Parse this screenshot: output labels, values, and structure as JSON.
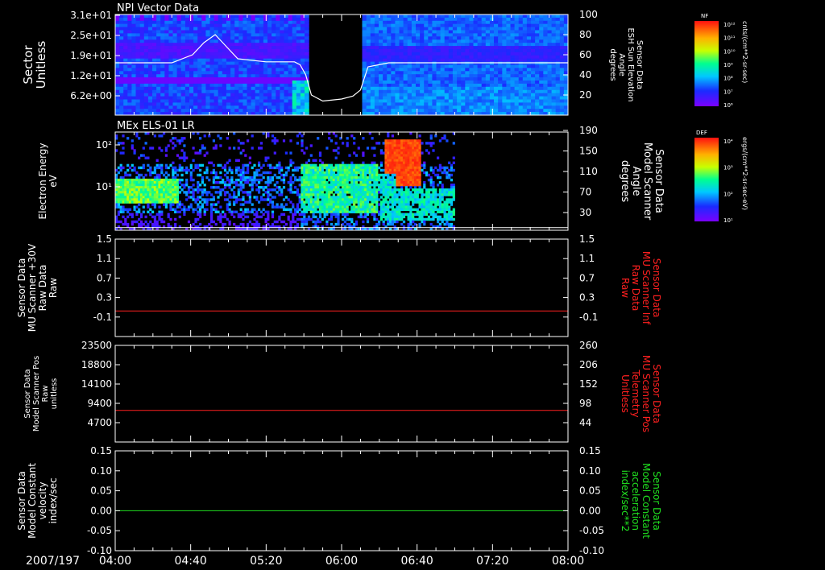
{
  "time_axis": {
    "date_label": "2007/197",
    "ticks": [
      "04:00",
      "04:40",
      "05:20",
      "06:00",
      "06:40",
      "07:20",
      "08:00"
    ],
    "range": [
      "04:00",
      "08:00"
    ]
  },
  "colors": {
    "background": "#000000",
    "foreground": "#ffffff",
    "red_trace": "#ff2020",
    "green_trace": "#20e020"
  },
  "colorbars": [
    {
      "label": "NF",
      "units": "cnts/(cm**2-sr-sec)",
      "ticks": [
        "10¹²",
        "10¹¹",
        "10¹⁰",
        "10⁹",
        "10⁸",
        "10⁷",
        "10⁶"
      ]
    },
    {
      "label": "DEF",
      "units": "ergs/(cm**2-sr-sec-eV)",
      "ticks": [
        "10⁴",
        "10³",
        "10²",
        "10¹"
      ]
    }
  ],
  "chart_data": [
    {
      "type": "heatmap",
      "title": "NPI Vector Data",
      "ylabel": [
        "Sector",
        "Unitless"
      ],
      "y_ticks": [
        "3.1e+01",
        "2.5e+01",
        "1.9e+01",
        "1.2e+01",
        "6.2e+00"
      ],
      "y2label": [
        "Sensor Data",
        "ESH Sun Elevation",
        "Angle",
        "degrees"
      ],
      "y2_ticks": [
        "100",
        "80",
        "60",
        "40",
        "20"
      ],
      "y2lim": [
        0,
        100
      ],
      "data_gap": [
        "05:44",
        "06:09"
      ],
      "overlay_line": {
        "name": "ESH Sun Elevation Angle",
        "x": [
          "04:00",
          "04:30",
          "04:41",
          "04:47",
          "04:53",
          "04:58",
          "05:05",
          "05:20",
          "05:35",
          "05:38",
          "05:41",
          "05:44",
          "05:50",
          "06:00",
          "06:06",
          "06:10",
          "06:14",
          "06:25",
          "07:00",
          "08:00"
        ],
        "y": [
          52,
          52,
          60,
          72,
          80,
          70,
          56,
          53,
          53,
          50,
          40,
          20,
          14,
          16,
          19,
          25,
          48,
          52,
          52,
          52
        ]
      }
    },
    {
      "type": "heatmap",
      "title": "MEx ELS-01 LR",
      "ylabel": [
        "Electron Energy",
        "eV"
      ],
      "y_ticks": [
        "10²",
        "10¹"
      ],
      "y2label": [
        "Sensor Data",
        "Model Scanner",
        "Angle",
        "degrees"
      ],
      "y2_ticks": [
        "190",
        "150",
        "110",
        "70",
        "30"
      ],
      "y2lim": [
        0,
        190
      ],
      "data_end": "07:00",
      "overlay_line": {
        "name": "Model Scanner Angle",
        "x": [
          "04:00",
          "08:00"
        ],
        "y": [
          5,
          5
        ]
      }
    },
    {
      "type": "line",
      "ylabel": [
        "Sensor Data",
        "MU Scanner +30V",
        "Raw Data",
        "Raw"
      ],
      "y_ticks": [
        "1.5",
        "1.1",
        "0.7",
        "0.3",
        "-0.1"
      ],
      "ylim": [
        -0.4,
        1.5
      ],
      "y2label": [
        "Sensor Data",
        "MU Scanner Inf",
        "Raw Data",
        "Raw"
      ],
      "y2_ticks": [
        "1.5",
        "1.1",
        "0.7",
        "0.3",
        "-0.1"
      ],
      "series": [
        {
          "name": "MU Scanner Inf Raw Data",
          "x": [
            "04:00",
            "08:00"
          ],
          "y": [
            0.1,
            0.1
          ]
        }
      ]
    },
    {
      "type": "line",
      "ylabel": [
        "Sensor Data",
        "Model Scanner Pos",
        "Raw",
        "unitless"
      ],
      "y_ticks": [
        "23500",
        "18800",
        "14100",
        "9400",
        "4700"
      ],
      "ylim": [
        0,
        23500
      ],
      "y2label": [
        "Sensor Data",
        "MU Scanner Pos",
        "Telemetry",
        "Unitless"
      ],
      "y2_ticks": [
        "260",
        "206",
        "152",
        "98",
        "44"
      ],
      "series": [
        {
          "name": "MU Scanner Pos Telemetry",
          "x": [
            "04:00",
            "08:00"
          ],
          "y": [
            7700,
            7700
          ]
        }
      ]
    },
    {
      "type": "line",
      "ylabel": [
        "Sensor Data",
        "Model Constant",
        "velocity",
        "index/sec"
      ],
      "y_ticks": [
        "0.15",
        "0.10",
        "0.05",
        "0.00",
        "-0.05",
        "-0.10"
      ],
      "ylim": [
        -0.1,
        0.15
      ],
      "y2label": [
        "Sensor Data",
        "Model Constant",
        "acceleration",
        "index/sec**2"
      ],
      "y2_ticks": [
        "0.15",
        "0.10",
        "0.05",
        "0.00",
        "-0.05",
        "-0.10"
      ],
      "series": [
        {
          "name": "Model Constant acceleration",
          "x": [
            "04:00",
            "08:00"
          ],
          "y": [
            0.0,
            0.0
          ]
        }
      ]
    }
  ]
}
